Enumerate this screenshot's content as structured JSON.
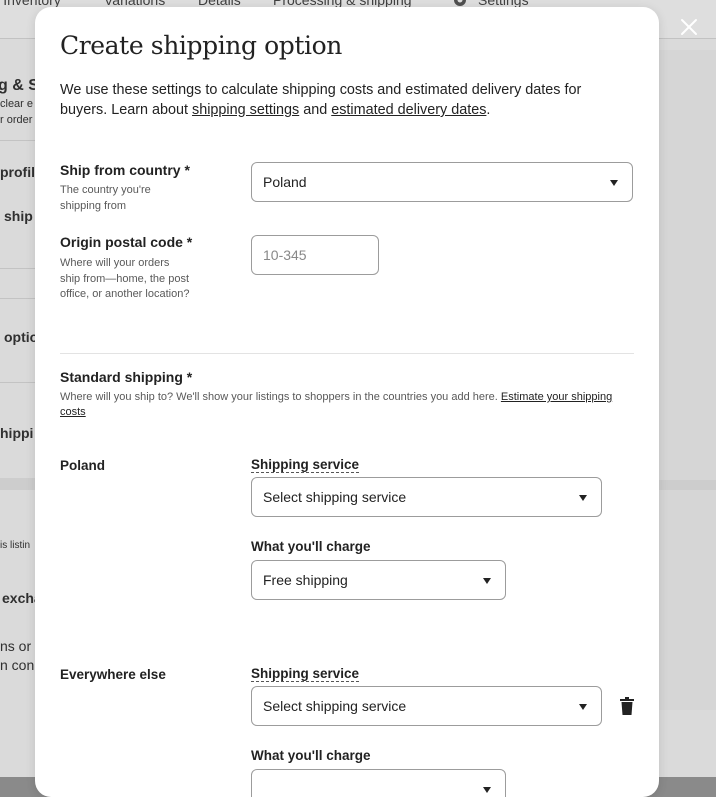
{
  "background": {
    "tabs": [
      "& Inventory",
      "Variations",
      "Details",
      "Processing & shipping",
      "Settings"
    ],
    "texts": [
      "g & S",
      "clear e",
      "r order",
      "profil",
      "ship",
      "optio",
      "hippi",
      "is listin",
      "excha",
      "ns or e",
      "n con"
    ]
  },
  "modal": {
    "title": "Create shipping option",
    "intro_text": "We use these settings to calculate shipping costs and estimated delivery dates for buyers. Learn about ",
    "intro_link1": "shipping settings",
    "intro_mid": " and ",
    "intro_link2": "estimated delivery dates",
    "intro_end": ".",
    "ship_from": {
      "label": "Ship from country *",
      "help": "The country you're shipping from",
      "value": "Poland"
    },
    "origin_postal": {
      "label": "Origin postal code *",
      "help": "Where will your orders ship from—home, the post office, or another location?",
      "placeholder": "10-345"
    },
    "standard": {
      "label": "Standard shipping *",
      "desc": "Where will you ship to? We'll show your listings to shoppers in the countries you add here. ",
      "desc_link": "Estimate your shipping costs"
    },
    "destinations": [
      {
        "country": "Poland",
        "service_label": "Shipping service",
        "service_value": "Select shipping service",
        "charge_label": "What you'll charge",
        "charge_value": "Free shipping"
      },
      {
        "country": "Everywhere else",
        "service_label": "Shipping service",
        "service_value": "Select shipping service",
        "charge_label": "What you'll charge"
      }
    ]
  },
  "icons": {
    "close": "close-icon",
    "delete": "trash-icon",
    "settings": "gear-icon"
  },
  "colors": {
    "text": "#222222",
    "help": "#595959",
    "border": "#9c9c9c",
    "overlay": "#8a8a8a"
  }
}
